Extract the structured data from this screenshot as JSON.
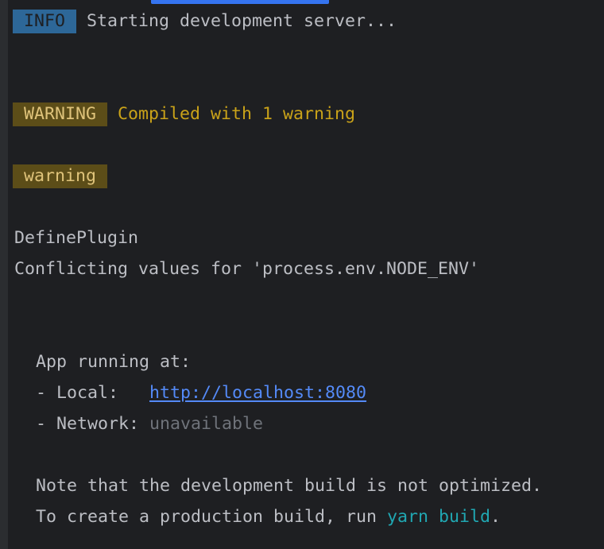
{
  "colors": {
    "background": "#1e1f22",
    "text": "#bcbec4",
    "info_badge": "#2d6798",
    "warning_badge": "#5c4d18",
    "warning_text": "#c9a219",
    "link": "#548af7",
    "dim": "#6f737a",
    "command": "#20a7b2",
    "tab_indicator": "#3574f0"
  },
  "info": {
    "badge": "INFO",
    "message": "Starting development server..."
  },
  "warning": {
    "badge": "WARNING",
    "message": "Compiled with 1 warning",
    "tag": "warning",
    "plugin": "DefinePlugin",
    "detail": "Conflicting values for 'process.env.NODE_ENV'"
  },
  "app": {
    "heading": "App running at:",
    "local_label": "- Local:   ",
    "local_url": "http://localhost:8080",
    "network_label": "- Network: ",
    "network_value": "unavailable"
  },
  "note": {
    "line1": "Note that the development build is not optimized.",
    "line2_prefix": "To create a production build, run ",
    "command": "yarn build",
    "line2_suffix": "."
  }
}
